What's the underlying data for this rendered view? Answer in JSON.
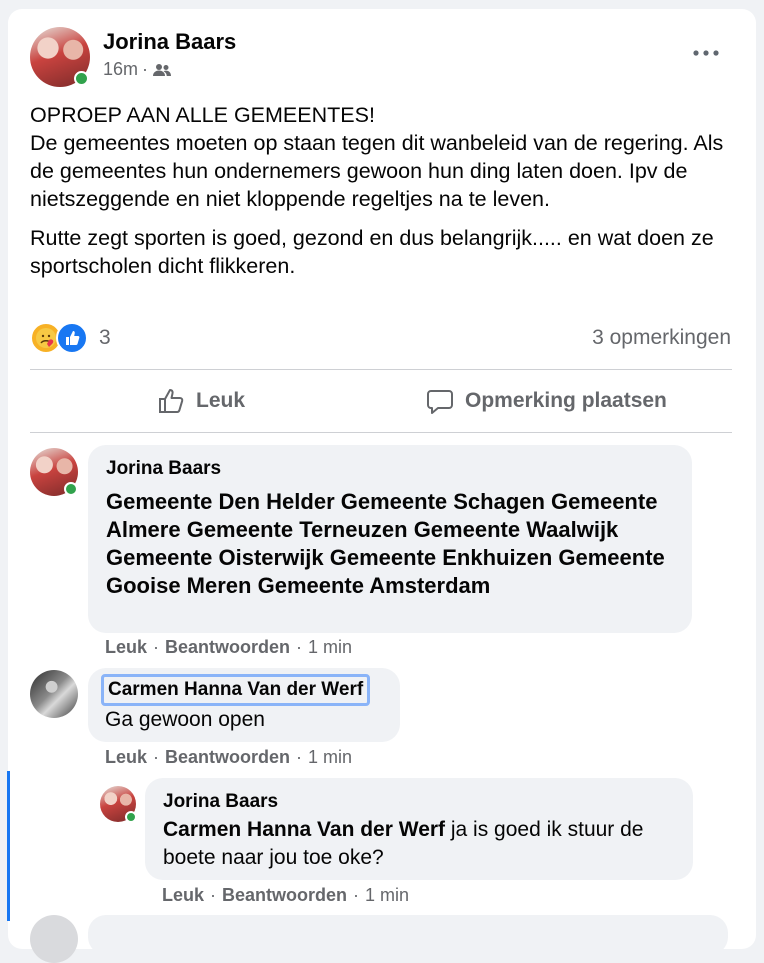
{
  "post": {
    "author": "Jorina Baars",
    "time": "16m",
    "separator": "·",
    "text_paragraphs": [
      "OPROEP AAN ALLE GEMEENTES!",
      "De gemeentes moeten op staan tegen dit wanbeleid van de regering. Als de gemeentes hun ondernemers gewoon hun ding laten doen. Ipv de nietszeggende en niet kloppende regeltjes na te leven.",
      "Rutte zegt sporten is goed, gezond en dus belangrijk..... en wat doen ze sportscholen dicht flikkeren."
    ],
    "reaction_count": "3",
    "comments_count": "3 opmerkingen"
  },
  "actions": {
    "like_label": "Leuk",
    "comment_label": "Opmerking plaatsen"
  },
  "comments": [
    {
      "author": "Jorina Baars",
      "text": "Gemeente Den Helder Gemeente Schagen Gemeente Almere Gemeente Terneuzen Gemeente Waalwijk Gemeente Oisterwijk Gemeente Enkhuizen Gemeente Gooise Meren Gemeente Amsterdam",
      "like": "Leuk",
      "reply": "Beantwoorden",
      "time": "1 min"
    },
    {
      "author": "Carmen Hanna Van der Werf",
      "text": "Ga gewoon open",
      "like": "Leuk",
      "reply": "Beantwoorden",
      "time": "1 min"
    },
    {
      "author": "Jorina Baars",
      "mention": "Carmen Hanna Van der Werf",
      "text": " ja is goed ik stuur de boete naar jou toe oke?",
      "like": "Leuk",
      "reply": "Beantwoorden",
      "time": "1 min"
    }
  ],
  "meta_separator": "·",
  "colors": {
    "online": "#31a24c",
    "like_blue": "#1877f2",
    "bubble": "#f0f2f5",
    "focus_outline": "#8ab4f8"
  }
}
